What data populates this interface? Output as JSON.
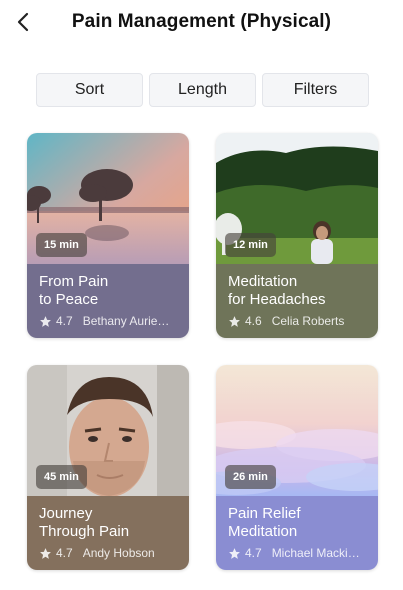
{
  "header": {
    "title": "Pain Management (Physical)",
    "back_icon": "chevron-left-icon"
  },
  "segments": [
    "Sort",
    "Length",
    "Filters"
  ],
  "cards": [
    {
      "duration": "15 min",
      "title": "From Pain\nto Peace",
      "rating": "4.7",
      "author": "Bethany Aurie…",
      "info_color": "#736e8e",
      "image": "sunset-lake-trees"
    },
    {
      "duration": "12 min",
      "title": "Meditation\nfor Headaches",
      "rating": "4.6",
      "author": "Celia Roberts",
      "info_color": "#6f7459",
      "image": "woman-in-field"
    },
    {
      "duration": "45 min",
      "title": "Journey\nThrough Pain",
      "rating": "4.7",
      "author": "Andy Hobson",
      "info_color": "#84705d",
      "image": "man-portrait"
    },
    {
      "duration": "26 min",
      "title": "Pain Relief\nMeditation",
      "rating": "4.7",
      "author": "Michael Macki…",
      "info_color": "#8a8dd2",
      "image": "pastel-clouds"
    }
  ],
  "icons": {
    "rating": "star-icon"
  }
}
